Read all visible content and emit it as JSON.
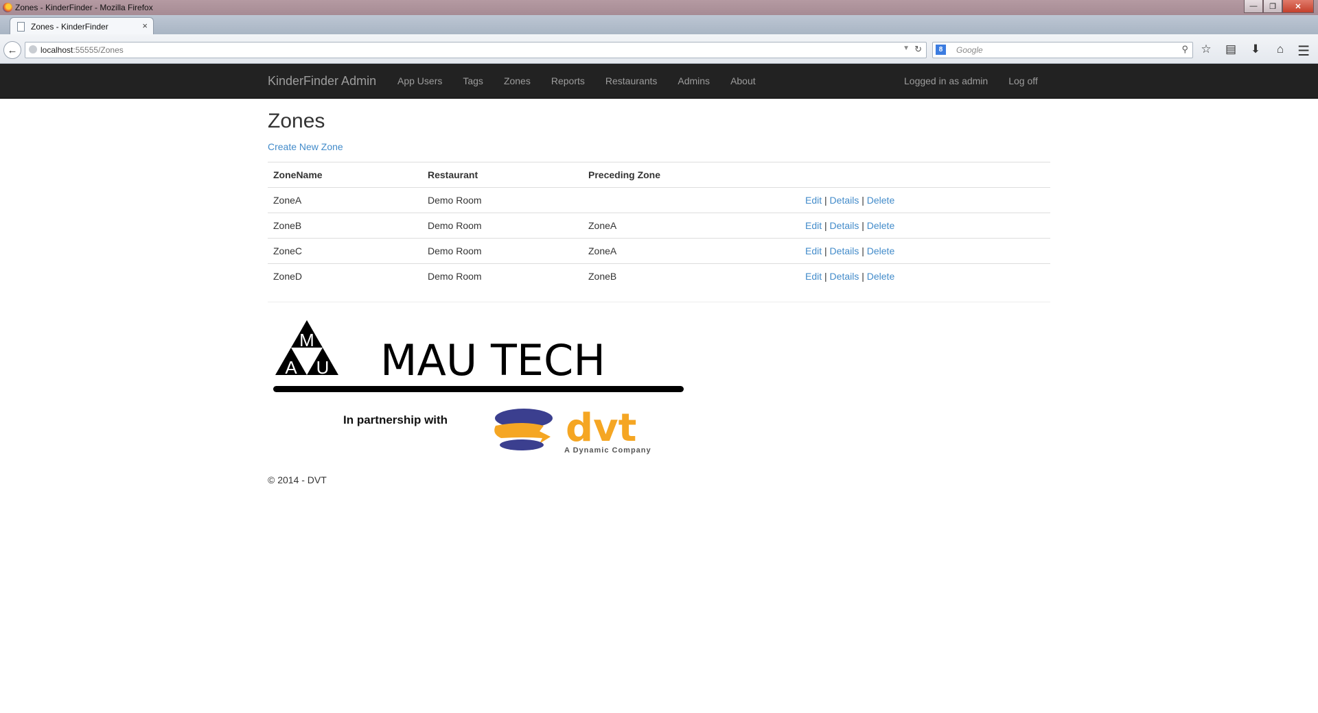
{
  "browser": {
    "window_title": "Zones - KinderFinder - Mozilla Firefox",
    "tab_title": "Zones - KinderFinder",
    "url_host": "localhost",
    "url_rest": ":55555/Zones",
    "search_placeholder": "Google",
    "new_tab": "+",
    "tab_close": "×"
  },
  "site_nav": {
    "brand": "KinderFinder Admin",
    "links": [
      "App Users",
      "Tags",
      "Zones",
      "Reports",
      "Restaurants",
      "Admins",
      "About"
    ],
    "logged_in": "Logged in as admin",
    "log_off": "Log off"
  },
  "page": {
    "title": "Zones",
    "create_link": "Create New Zone"
  },
  "table": {
    "headers": [
      "ZoneName",
      "Restaurant",
      "Preceding Zone"
    ],
    "rows": [
      {
        "zone": "ZoneA",
        "restaurant": "Demo Room",
        "preceding": ""
      },
      {
        "zone": "ZoneB",
        "restaurant": "Demo Room",
        "preceding": "ZoneA"
      },
      {
        "zone": "ZoneC",
        "restaurant": "Demo Room",
        "preceding": "ZoneA"
      },
      {
        "zone": "ZoneD",
        "restaurant": "Demo Room",
        "preceding": "ZoneB"
      }
    ],
    "actions": {
      "edit": "Edit",
      "details": "Details",
      "delete": "Delete",
      "sep": "|"
    }
  },
  "footer": {
    "logo_letters": {
      "m": "M",
      "a": "A",
      "u": "U"
    },
    "logo_name": "MAU TECH",
    "partnership": "In partnership with",
    "partner_name": "dvt",
    "partner_tagline": "A Dynamic Company",
    "copyright": "© 2014 - DVT"
  },
  "colors": {
    "link": "#428bca",
    "navbar_bg": "#222222",
    "dvt_orange": "#f5a623",
    "dvt_blue": "#3b3f8f"
  }
}
